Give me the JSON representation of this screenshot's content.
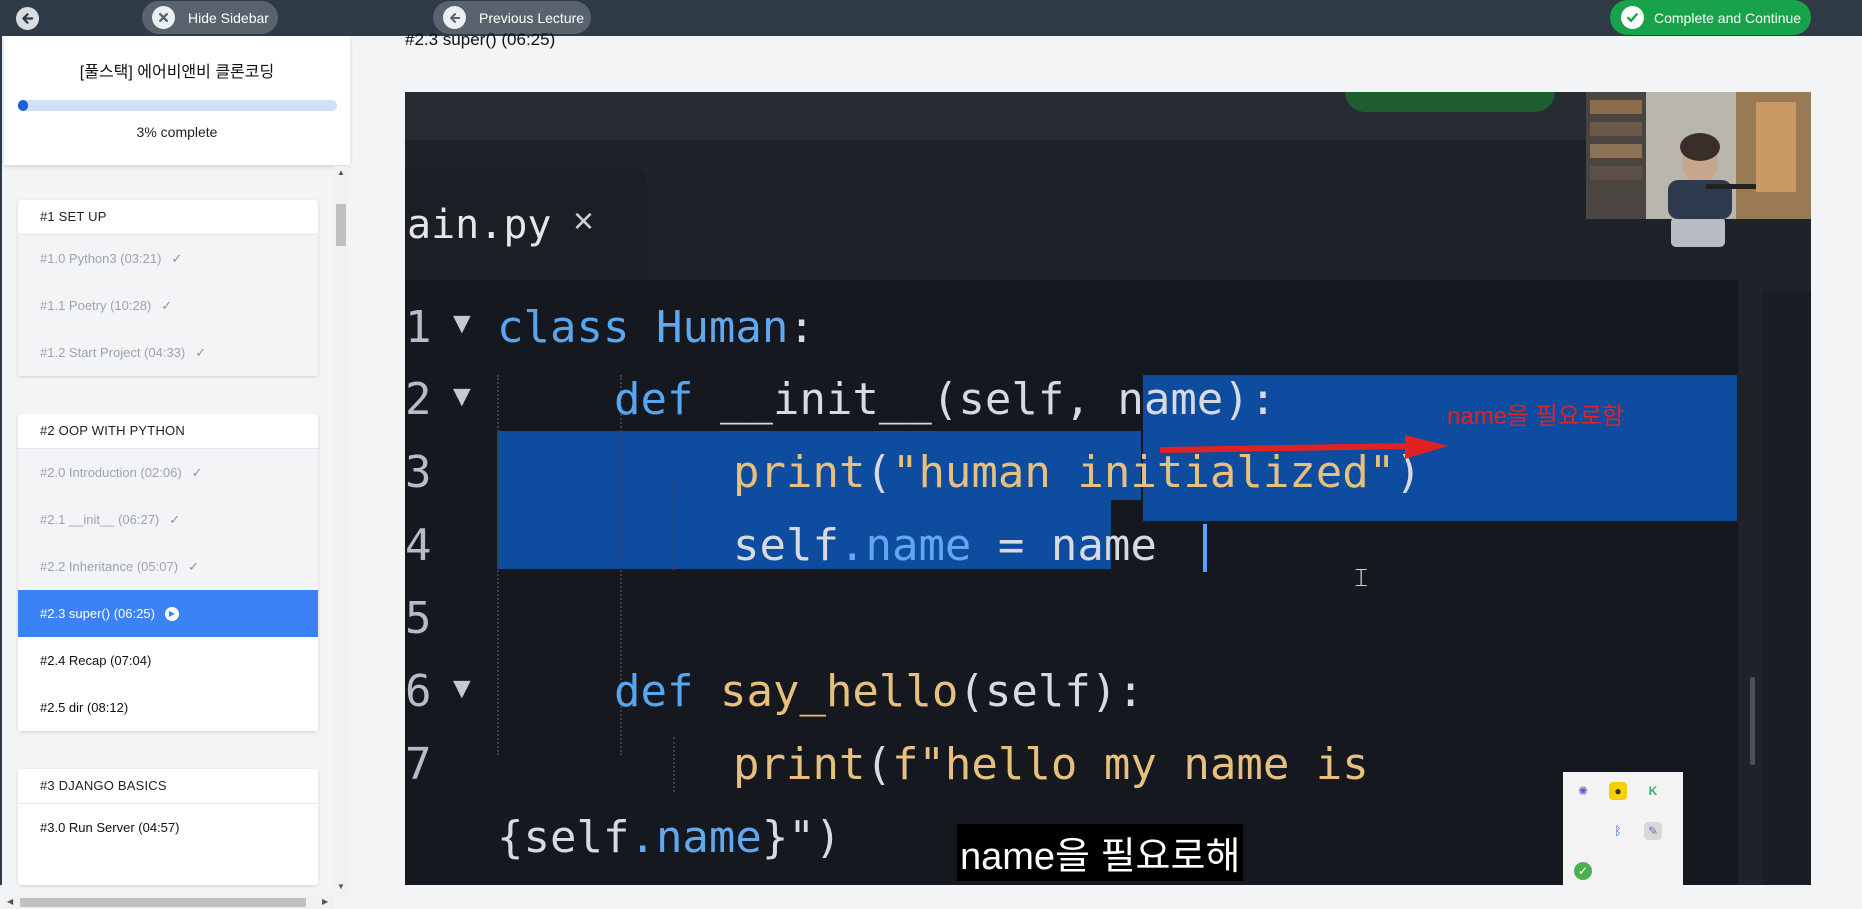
{
  "topbar": {
    "hide_sidebar": "Hide Sidebar",
    "previous_lecture": "Previous Lecture",
    "complete_continue": "Complete and Continue"
  },
  "course": {
    "title": "[풀스택] 에어비앤비 클론코딩",
    "progress_percent": 3,
    "progress_label": "3% complete"
  },
  "sections": [
    {
      "title": "#1 SET UP",
      "lectures": [
        {
          "label": "#1.0 Python3 (03:21)",
          "state": "done"
        },
        {
          "label": "#1.1 Poetry (10:28)",
          "state": "done"
        },
        {
          "label": "#1.2 Start Project (04:33)",
          "state": "done"
        }
      ]
    },
    {
      "title": "#2 OOP WITH PYTHON",
      "lectures": [
        {
          "label": "#2.0 Introduction (02:06)",
          "state": "done"
        },
        {
          "label": "#2.1 __init__ (06:27)",
          "state": "done"
        },
        {
          "label": "#2.2 Inheritance (05:07)",
          "state": "done"
        },
        {
          "label": "#2.3 super() (06:25)",
          "state": "active"
        },
        {
          "label": "#2.4 Recap (07:04)",
          "state": "todo"
        },
        {
          "label": "#2.5 dir (08:12)",
          "state": "todo"
        }
      ]
    },
    {
      "title": "#3 DJANGO BASICS",
      "lectures": [
        {
          "label": "#3.0 Run Server (04:57)",
          "state": "todo"
        }
      ]
    }
  ],
  "main": {
    "lecture_title": "#2.3 super() (06:25)"
  },
  "video": {
    "tab_filename": "ain.py",
    "tab_close": "×",
    "line_numbers": [
      "1",
      "2",
      "3",
      "4",
      "5",
      "6",
      "7"
    ],
    "code": {
      "l1_kw": "class",
      "l1_name": "Human",
      "l1_rest": ":",
      "l2_kw": "def",
      "l2_fn": "__init__",
      "l2_rest": "(self, name):",
      "l3_fn": "print",
      "l3_open": "(",
      "l3_str": "\"human initialized\"",
      "l3_close": ")",
      "l4_self": "self",
      "l4_attr": ".name",
      "l4_rest": " = name",
      "l6_kw": "def",
      "l6_fn": "say_hello",
      "l6_rest": "(self):",
      "l7_fn": "print",
      "l7_open": "(",
      "l7_str": "f\"hello my name is",
      "l8_open": "{self",
      "l8_attr": ".name",
      "l8_close": "}\")"
    },
    "annotation": "name을 필요로함",
    "caption": "name을 필요로해"
  },
  "colors": {
    "topbar": "#2f3a47",
    "accent_blue": "#3b82f6",
    "complete_green": "#18a34a",
    "annotation_red": "#e12222"
  }
}
